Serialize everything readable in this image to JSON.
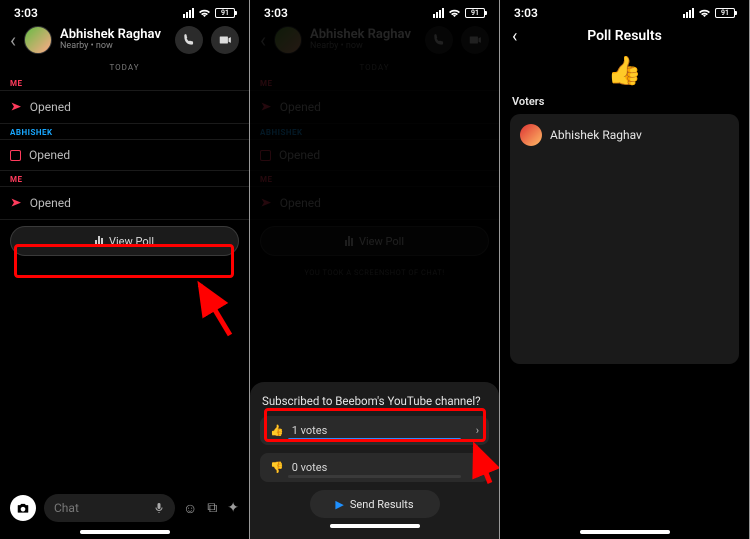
{
  "status": {
    "time": "3:03",
    "battery": "91"
  },
  "contact": {
    "name": "Abhishek Raghav",
    "presence": "Nearby • now"
  },
  "day_label": "TODAY",
  "labels": {
    "me": "ME",
    "other": "ABHISHEK"
  },
  "msg": {
    "opened": "Opened"
  },
  "view_poll": "View Poll",
  "screenshot_note": "YOU TOOK A SCREENSHOT OF CHAT!",
  "chat_placeholder": "Chat",
  "poll": {
    "question": "Subscribed to Beebom's YouTube channel?",
    "options": [
      {
        "emoji": "👍",
        "votes_text": "1 votes",
        "fill_pct": 100
      },
      {
        "emoji": "👎",
        "votes_text": "0 votes",
        "fill_pct": 0
      }
    ],
    "send": "Send Results"
  },
  "results": {
    "title": "Poll Results",
    "emoji": "👍",
    "voters_label": "Voters",
    "voters": [
      {
        "name": "Abhishek Raghav"
      }
    ]
  }
}
